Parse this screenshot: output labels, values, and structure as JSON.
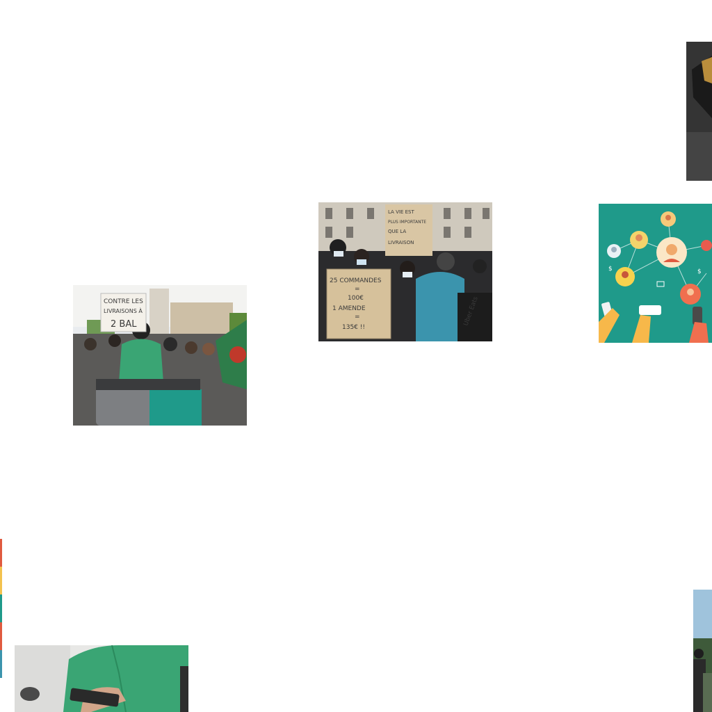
{
  "collage": {
    "tiles": [
      {
        "id": "protest-left",
        "subject": "protest-photo",
        "sign_lines": [
          "CONTRE LES",
          "LIVRAISONS À",
          "2 BAL"
        ]
      },
      {
        "id": "protest-center",
        "subject": "protest-photo",
        "sign_top_lines": [
          "LA VIE EST",
          "PLUS IMPORTANTE",
          "QUE LA",
          "LIVRAISON"
        ],
        "sign_bottom_lines": [
          "25 COMMANDES",
          "=",
          "100€",
          "1 AMENDE",
          "=",
          "135€ !!"
        ],
        "jacket_text": "Uber Eats"
      },
      {
        "id": "network",
        "subject": "social-network-illustration",
        "symbols": [
          "$",
          "$"
        ]
      },
      {
        "id": "dark-top",
        "subject": "photo-fragment"
      },
      {
        "id": "courier-phone",
        "subject": "courier-with-phone-photo"
      },
      {
        "id": "edge-left",
        "subject": "photo-fragment"
      },
      {
        "id": "edge-right",
        "subject": "photo-fragment"
      }
    ]
  },
  "colors": {
    "background": "#ffffff",
    "teal": "#1f9a8a",
    "courier_green": "#3aa574",
    "sign_board": "#d9c6a4",
    "network_bg": "#1f9a8a"
  }
}
